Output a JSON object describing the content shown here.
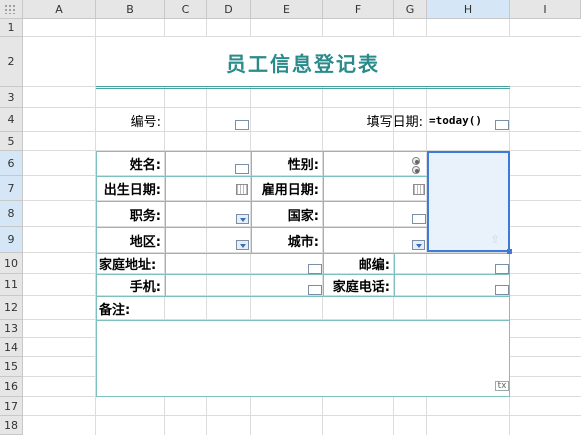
{
  "columns": [
    "A",
    "B",
    "C",
    "D",
    "E",
    "F",
    "G",
    "H",
    "I"
  ],
  "rows": [
    "1",
    "2",
    "3",
    "4",
    "5",
    "6",
    "7",
    "8",
    "9",
    "10",
    "11",
    "12",
    "13",
    "14",
    "15",
    "16",
    "17",
    "18"
  ],
  "selected_column": "H",
  "form": {
    "title": "员工信息登记表",
    "number_label": "编号:",
    "fill_date_label": "填写日期:",
    "fill_date_formula": "=today()",
    "name_label": "姓名:",
    "gender_label": "性别:",
    "birth_label": "出生日期:",
    "hire_label": "雇用日期:",
    "position_label": "职务:",
    "country_label": "国家:",
    "region_label": "地区:",
    "city_label": "城市:",
    "address_label": "家庭地址:",
    "zip_label": "邮编:",
    "mobile_label": "手机:",
    "home_phone_label": "家庭电话:",
    "notes_label": "备注:",
    "notes_widget_text": "tx"
  },
  "colors": {
    "title": "#2b8a8a",
    "table_border": "#7ec0c0",
    "selection": "#3d7bd9"
  },
  "icons": {
    "image_upload": "upload-arrow-icon",
    "calendar": "calendar-icon",
    "dropdown": "dropdown-arrow-icon"
  }
}
